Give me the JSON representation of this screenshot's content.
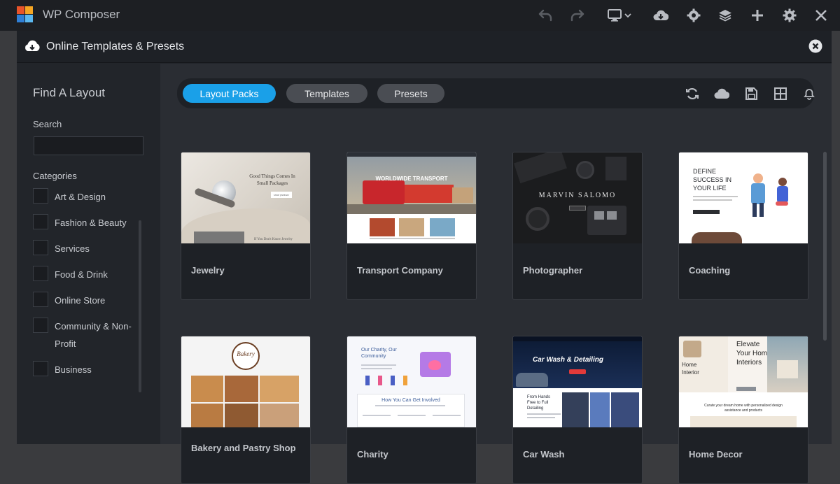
{
  "app": {
    "title": "WP Composer"
  },
  "toolbar_icons": [
    "undo-icon",
    "redo-icon",
    "monitor-icon",
    "chevron-down-icon",
    "cloud-download-icon",
    "settings-cog-icon",
    "layers-icon",
    "plus-icon",
    "gear-icon",
    "close-icon"
  ],
  "dialog": {
    "title": "Online Templates & Presets"
  },
  "sidebar": {
    "heading": "Find A Layout",
    "search_label": "Search",
    "search_value": "",
    "categories_label": "Categories",
    "categories": [
      {
        "label": "Art & Design"
      },
      {
        "label": "Fashion & Beauty"
      },
      {
        "label": "Services"
      },
      {
        "label": "Food & Drink"
      },
      {
        "label": "Online Store"
      },
      {
        "label": "Community & Non-Profit"
      },
      {
        "label": "Business"
      }
    ]
  },
  "tabs": [
    {
      "label": "Layout Packs",
      "active": true
    },
    {
      "label": "Templates",
      "active": false
    },
    {
      "label": "Presets",
      "active": false
    }
  ],
  "tool_icons": [
    "refresh-icon",
    "cloud-icon",
    "save-icon",
    "grid-icon",
    "bell-icon"
  ],
  "cards": [
    {
      "label": "Jewelry",
      "thumb_texts": [
        "Good Things Comes In",
        "Small Packages",
        "SHOP JEWELRY",
        "If You Don't Know Jewelry"
      ]
    },
    {
      "label": "Transport Company",
      "thumb_texts": [
        "WORLDWIDE TRANSPORT"
      ]
    },
    {
      "label": "Photographer",
      "thumb_texts": [
        "MARVIN SALOMO"
      ]
    },
    {
      "label": "Coaching",
      "thumb_texts": [
        "DEFINE",
        "SUCCESS IN",
        "YOUR LIFE"
      ]
    },
    {
      "label": "Bakery and Pastry Shop",
      "thumb_texts": [
        "Bakery"
      ]
    },
    {
      "label": "Charity",
      "thumb_texts": [
        "Our Charity, Our",
        "Community",
        "How You Can Get Involved"
      ]
    },
    {
      "label": "Car Wash",
      "thumb_texts": [
        "Car Wash & Detailing",
        "From Hands",
        "Free to Full",
        "Detailing"
      ]
    },
    {
      "label": "Home Decor",
      "thumb_texts": [
        "Elevate",
        "Your Home",
        "Interiors",
        "Home",
        "Interior",
        "Curate your dream home with personalized design",
        "assistance and products"
      ]
    }
  ]
}
